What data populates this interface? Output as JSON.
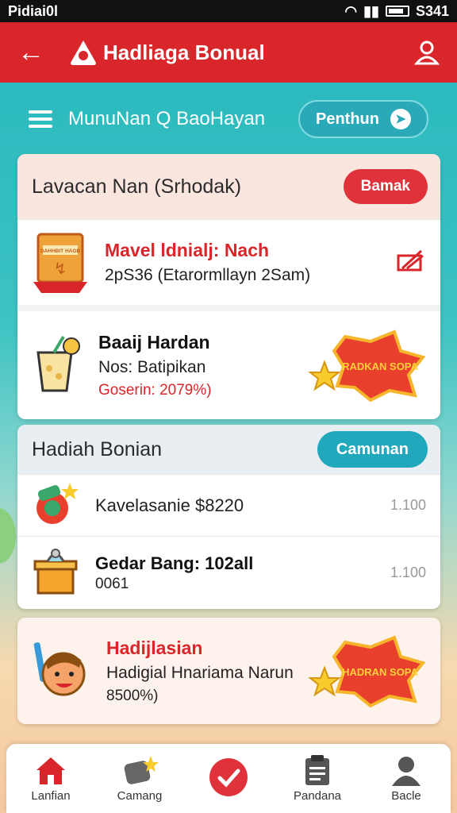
{
  "status_bar": {
    "carrier": "Pidiai0l",
    "time": "S341"
  },
  "app_bar": {
    "title": "Hadliaga Bonual"
  },
  "sub_bar": {
    "title": "MunuNan Q BaoHayan",
    "pill_label": "Penthun"
  },
  "section1": {
    "heading": "Lavacan Nan (Srhodak)",
    "button": "Bamak",
    "item1": {
      "icon_label": "DAHHBIT HAGB",
      "title": "Mavel ldnialj: Nach",
      "subtitle": "2pS36 (Etarormllayn 2Sam)"
    },
    "item2": {
      "title": "Baaij Hardan",
      "line": "Nos: Batipikan",
      "line_red": "Goserin: 2079%)",
      "badge": "RADKAN SOPA"
    }
  },
  "section2": {
    "heading": "Hadiah Bonian",
    "button": "Camunan",
    "rows": [
      {
        "title": "Kavelasanie $8220",
        "amount": "1.100"
      },
      {
        "title": "Gedar Bang: 102all",
        "subtitle": "0061",
        "amount": "1.100"
      }
    ]
  },
  "section3": {
    "title": "Hadijlasian",
    "line": "Hadigial Hnariama Narun",
    "line2": "8500%)",
    "badge": "HADRAN SOPA"
  },
  "bottom_nav": [
    {
      "label": "Lanfian"
    },
    {
      "label": "Camang"
    },
    {
      "label": ""
    },
    {
      "label": "Pandana"
    },
    {
      "label": "Bacle"
    }
  ],
  "colors": {
    "primary_red": "#d8262b",
    "teal": "#21a8bd",
    "background_teal": "#27b7bd"
  }
}
